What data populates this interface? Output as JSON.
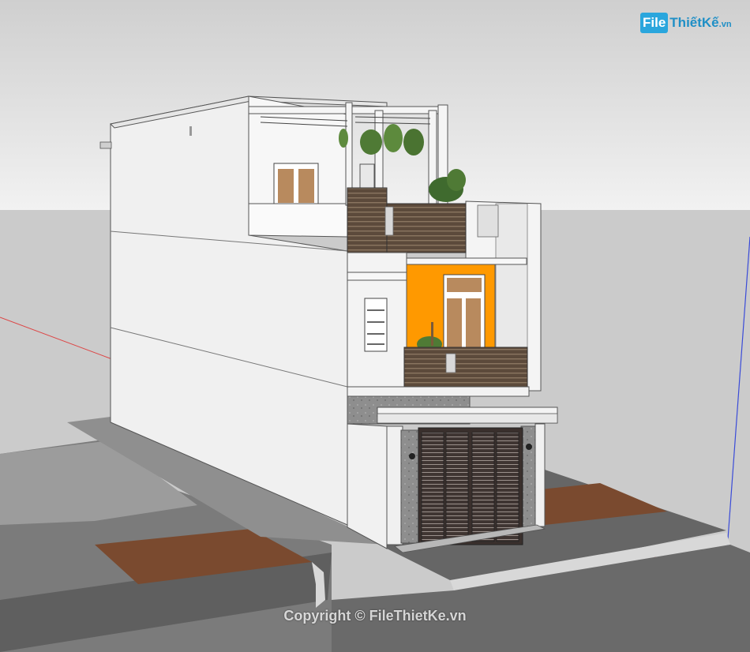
{
  "watermark": {
    "logo_file": "File",
    "logo_word": "ThiếtKế",
    "logo_tld": ".vn",
    "copyright": "Copyright © FileThietKe.vn"
  },
  "palette": {
    "sky_top": "#dcdcdc",
    "ground": "#cccccc",
    "road": "#7a7a7a",
    "pavement": "#5e5e5e",
    "wall_light": "#f4f4f4",
    "wall_shade": "#e0e0e0",
    "accent_orange": "#ff9900",
    "wood": "#5b4636",
    "door_dark": "#4a3f3a",
    "tile_brown": "#7c4a30",
    "stone": "#8c8c8c"
  }
}
